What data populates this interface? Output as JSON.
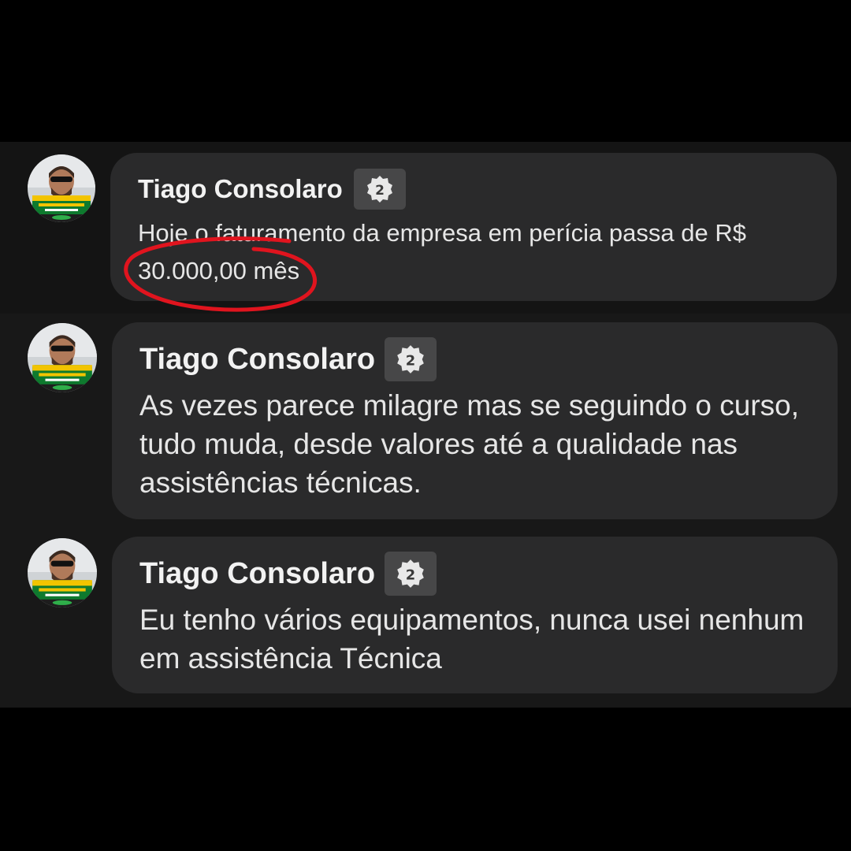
{
  "comments": [
    {
      "author": "Tiago Consolaro",
      "badge": "2",
      "text": "Hoje o faturamento da empresa em perícia passa de R$ 30.000,00 mês",
      "avatar_lines": [
        "EU APOIO",
        "VOTO IMPRESSO",
        "AUDITÁVEL"
      ]
    },
    {
      "author": "Tiago Consolaro",
      "badge": "2",
      "text": "As vezes parece milagre mas se seguindo o curso, tudo muda, desde valores até a qualidade nas assistências técnicas.",
      "avatar_lines": [
        "EU APOIO",
        "VOTO IMPRESSO",
        "AUDITÁVEL"
      ]
    },
    {
      "author": "Tiago Consolaro",
      "badge": "2",
      "text": "Eu tenho vários equipamentos, nunca usei nenhum em assistência Técnica",
      "avatar_lines": [
        "EU APOIO",
        "VOTO IMPRESSO",
        "AUDITÁVEL"
      ]
    }
  ],
  "annotation_color": "#e0141e",
  "colors": {
    "page_background": "#000000",
    "thread_background": "#141414",
    "bubble_background": "#2a2a2b",
    "author_text": "#f2f2f2",
    "body_text": "#e6e6e6",
    "badge_background": "#474748"
  }
}
